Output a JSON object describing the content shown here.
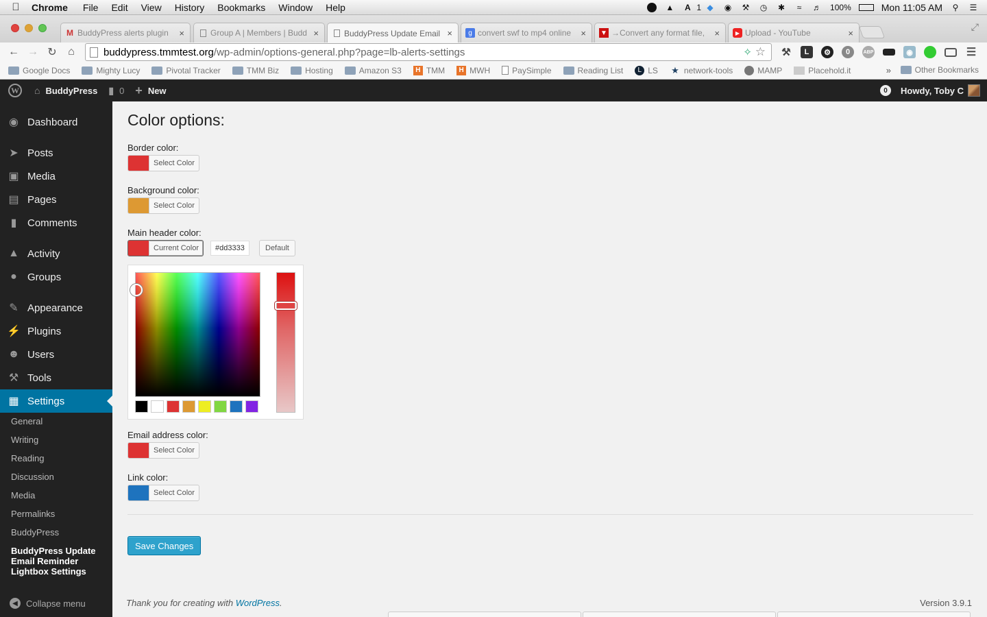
{
  "mac_menubar": {
    "app": "Chrome",
    "menus": [
      "File",
      "Edit",
      "View",
      "History",
      "Bookmarks",
      "Window",
      "Help"
    ],
    "status": {
      "adobe_count": "1",
      "battery": "100%",
      "clock": "Mon 11:05 AM"
    }
  },
  "tabs": [
    {
      "title": "BuddyPress alerts plugin",
      "icon": "gmail-icon",
      "active": false
    },
    {
      "title": "Group A | Members | Budd",
      "icon": "page-icon",
      "active": false
    },
    {
      "title": "BuddyPress Update Email",
      "icon": "page-icon",
      "active": true
    },
    {
      "title": "convert swf to mp4 online",
      "icon": "google-icon",
      "active": false
    },
    {
      "title": "→Convert any format file,",
      "icon": "convert-icon",
      "active": false
    },
    {
      "title": "Upload - YouTube",
      "icon": "youtube-icon",
      "active": false
    }
  ],
  "address_bar": {
    "host": "buddypress.tmmtest.org",
    "path": "/wp-admin/options-general.php?page=lb-alerts-settings"
  },
  "bookmarks": [
    {
      "label": "Google Docs",
      "type": "folder"
    },
    {
      "label": "Mighty Lucy",
      "type": "folder"
    },
    {
      "label": "Pivotal Tracker",
      "type": "folder"
    },
    {
      "label": "TMM Biz",
      "type": "folder"
    },
    {
      "label": "Hosting",
      "type": "folder"
    },
    {
      "label": "Amazon S3",
      "type": "folder"
    },
    {
      "label": "TMM",
      "type": "h"
    },
    {
      "label": "MWH",
      "type": "h"
    },
    {
      "label": "PaySimple",
      "type": "doc"
    },
    {
      "label": "Reading List",
      "type": "folder"
    },
    {
      "label": "LS",
      "type": "ls"
    },
    {
      "label": "network-tools",
      "type": "star"
    },
    {
      "label": "MAMP",
      "type": "mamp"
    },
    {
      "label": "Placehold.it",
      "type": "img"
    }
  ],
  "bookmarks_overflow": "»",
  "bookmarks_other": "Other Bookmarks",
  "admin_bar": {
    "site_name": "BuddyPress",
    "comments_count": "0",
    "new_label": "New",
    "notifications": "0",
    "greeting": "Howdy, Toby C"
  },
  "sidebar": {
    "items": [
      {
        "label": "Dashboard",
        "icon": "dashboard-icon"
      },
      {
        "label": "Posts",
        "icon": "pin-icon"
      },
      {
        "label": "Media",
        "icon": "media-icon"
      },
      {
        "label": "Pages",
        "icon": "pages-icon"
      },
      {
        "label": "Comments",
        "icon": "comment-icon"
      },
      {
        "label": "Activity",
        "icon": "activity-icon"
      },
      {
        "label": "Groups",
        "icon": "groups-icon"
      },
      {
        "label": "Appearance",
        "icon": "brush-icon"
      },
      {
        "label": "Plugins",
        "icon": "plug-icon"
      },
      {
        "label": "Users",
        "icon": "user-icon"
      },
      {
        "label": "Tools",
        "icon": "wrench-icon"
      },
      {
        "label": "Settings",
        "icon": "settings-icon"
      }
    ],
    "submenu": [
      "General",
      "Writing",
      "Reading",
      "Discussion",
      "Media",
      "Permalinks",
      "BuddyPress",
      "BuddyPress Update Email Reminder Lightbox Settings"
    ],
    "collapse_label": "Collapse menu"
  },
  "page": {
    "title": "Color options:",
    "fields": [
      {
        "label": "Border color:",
        "button": "Select Color",
        "color": "#dd3333"
      },
      {
        "label": "Background color:",
        "button": "Select Color",
        "color": "#dd9933"
      },
      {
        "label": "Main header color:",
        "button": "Current Color",
        "color": "#dd3333",
        "hex": "#dd3333",
        "default_label": "Default"
      },
      {
        "label": "Email address color:",
        "button": "Select Color",
        "color": "#dd3333"
      },
      {
        "label": "Link color:",
        "button": "Select Color",
        "color": "#1e73be"
      }
    ],
    "palette": [
      "#000000",
      "#ffffff",
      "#dd3333",
      "#dd9933",
      "#eeee22",
      "#81d742",
      "#1e73be",
      "#8224e3"
    ],
    "save_label": "Save Changes",
    "footer_thanks": "Thank you for creating with ",
    "footer_link": "WordPress",
    "footer_period": ".",
    "version": "Version 3.9.1"
  },
  "colors": {
    "admin_dark": "#222222",
    "accent": "#0074a2",
    "button_primary": "#2ea2cc"
  }
}
